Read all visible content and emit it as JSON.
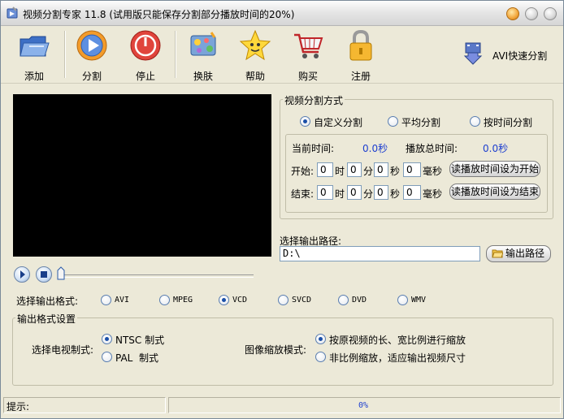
{
  "window": {
    "title": "视频分割专家 11.8 (试用版只能保存分割部分播放时间的20%)"
  },
  "toolbar": {
    "add": "添加",
    "split": "分割",
    "stop": "停止",
    "skin": "换肤",
    "help": "帮助",
    "buy": "购买",
    "register": "注册",
    "avi_fast": "AVI快速分割"
  },
  "split_mode": {
    "title": "视频分割方式",
    "options": [
      "自定义分割",
      "平均分割",
      "按时间分割"
    ],
    "selected": "自定义分割",
    "current_time_label": "当前时间:",
    "current_time_value": "0.0秒",
    "total_time_label": "播放总时间:",
    "total_time_value": "0.0秒",
    "start_label": "开始:",
    "end_label": "结束:",
    "start": {
      "h": "0",
      "m": "0",
      "s": "0",
      "ms": "0"
    },
    "end": {
      "h": "0",
      "m": "0",
      "s": "0",
      "ms": "0"
    },
    "unit_h": "时",
    "unit_m": "分",
    "unit_s": "秒",
    "unit_ms": "毫秒",
    "set_start_button": "读播放时间设为开始",
    "set_end_button": "读播放时间设为结束"
  },
  "output_path": {
    "label": "选择输出路径:",
    "value": "D:\\",
    "button": "输出路径"
  },
  "output_format": {
    "label": "选择输出格式:",
    "options": [
      "AVI",
      "MPEG",
      "VCD",
      "SVCD",
      "DVD",
      "WMV"
    ],
    "selected": "VCD"
  },
  "format_settings": {
    "title": "输出格式设置",
    "tv_label": "选择电视制式:",
    "tv_options": [
      "NTSC 制式",
      "PAL  制式"
    ],
    "tv_selected": "NTSC 制式",
    "scale_label": "图像缩放模式:",
    "scale_options": [
      "按原视频的长、宽比例进行缩放",
      "非比例缩放，适应输出视频尺寸"
    ],
    "scale_selected": "按原视频的长、宽比例进行缩放"
  },
  "status": {
    "hint_label": "提示:",
    "progress": "0%"
  },
  "colors": {
    "accent_blue": "#1d3fd0",
    "window_bg": "#ece9d8"
  }
}
